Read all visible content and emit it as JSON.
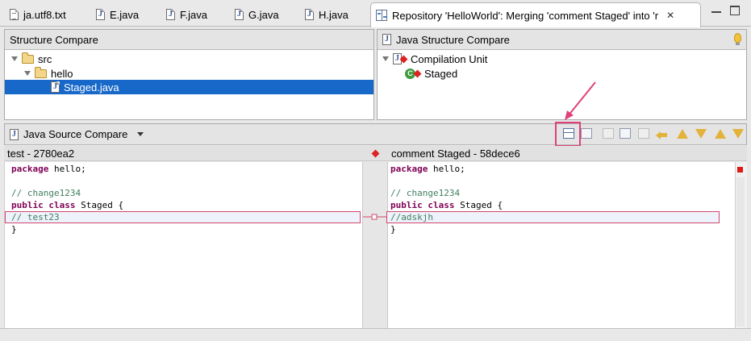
{
  "tabs": [
    {
      "label": "ja.utf8.txt",
      "icon": "text-file-icon"
    },
    {
      "label": "E.java",
      "icon": "java-file-icon"
    },
    {
      "label": "F.java",
      "icon": "java-file-icon"
    },
    {
      "label": "G.java",
      "icon": "java-file-icon"
    },
    {
      "label": "H.java",
      "icon": "java-file-icon"
    },
    {
      "label": "Repository 'HelloWorld': Merging 'comment Staged' into 'r",
      "icon": "compare-editor-icon",
      "active": true
    }
  ],
  "structure_compare": {
    "title": "Structure Compare",
    "tree": [
      {
        "label": "src",
        "level": 0,
        "icon": "folder-icon",
        "expanded": true
      },
      {
        "label": "hello",
        "level": 1,
        "icon": "package-folder-icon",
        "expanded": true
      },
      {
        "label": "Staged.java",
        "level": 2,
        "icon": "java-file-icon",
        "selected": true
      }
    ]
  },
  "java_structure_compare": {
    "title": "Java Structure Compare",
    "tree": [
      {
        "label": "Compilation Unit",
        "level": 0,
        "icon": "compilation-unit-icon"
      },
      {
        "label": "Staged",
        "level": 1,
        "icon": "class-icon"
      }
    ]
  },
  "source_compare": {
    "title": "Java Source Compare",
    "left_header": "test - 2780ea2",
    "right_header": "comment Staged - 58dece6",
    "left_lines": [
      [
        {
          "t": "package",
          "k": "kw"
        },
        {
          "t": " hello;"
        }
      ],
      [],
      [
        {
          "t": "// change1234",
          "k": "cm"
        }
      ],
      [
        {
          "t": "public",
          "k": "kw"
        },
        {
          "t": " "
        },
        {
          "t": "class",
          "k": "kw"
        },
        {
          "t": " Staged {"
        }
      ],
      [
        {
          "t": "// test23",
          "k": "cm"
        }
      ],
      [
        {
          "t": "}"
        }
      ]
    ],
    "right_lines": [
      [
        {
          "t": "package",
          "k": "kw"
        },
        {
          "t": " hello;"
        }
      ],
      [],
      [
        {
          "t": "// change1234",
          "k": "cm"
        }
      ],
      [
        {
          "t": "public",
          "k": "kw"
        },
        {
          "t": " "
        },
        {
          "t": "class",
          "k": "kw"
        },
        {
          "t": " Staged {"
        }
      ],
      [
        {
          "t": "//adskjh",
          "k": "cm"
        }
      ],
      [
        {
          "t": "}"
        }
      ]
    ],
    "changed_line_index": 4
  },
  "colors": {
    "selection": "#1768c8",
    "keyword": "#7f0055",
    "comment": "#3f7f5f",
    "change_border": "#d3476d",
    "annotation_highlight": "#e0407a"
  }
}
